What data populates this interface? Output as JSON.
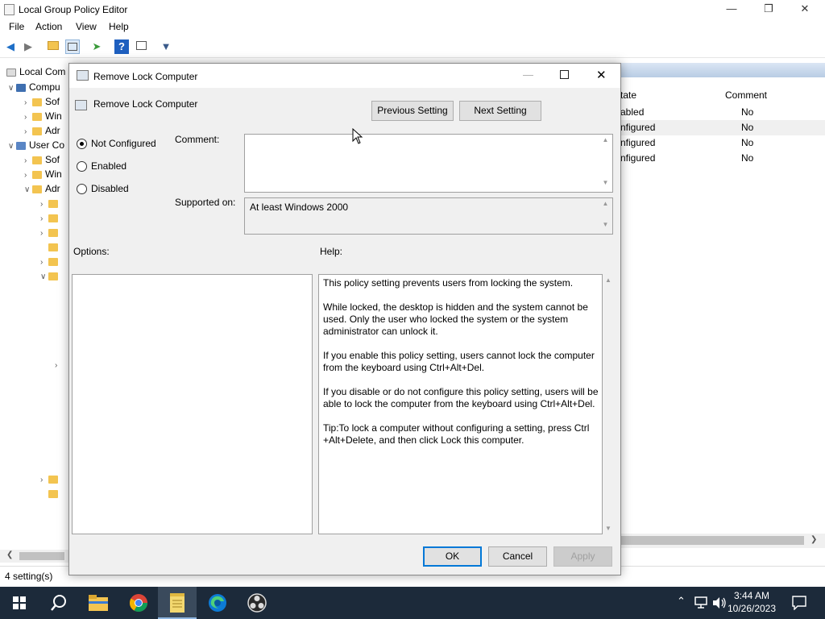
{
  "main_window": {
    "title": "Local Group Policy Editor",
    "controls": {
      "minimize": "—",
      "restore": "❐",
      "close": "✕"
    },
    "menu": [
      "File",
      "Action",
      "View",
      "Help"
    ],
    "toolbar_icons": [
      "back-arrow-icon",
      "forward-arrow-icon",
      "folder-up-icon",
      "show-hide-tree-icon",
      "export-list-icon",
      "help-icon",
      "properties-icon",
      "filter-icon"
    ],
    "tree": [
      {
        "label": "Local Com",
        "indent": 0
      },
      {
        "label": "Compu",
        "indent": 1
      },
      {
        "label": "Sof",
        "indent": 2
      },
      {
        "label": "Win",
        "indent": 2
      },
      {
        "label": "Adr",
        "indent": 2
      },
      {
        "label": "User Co",
        "indent": 1
      },
      {
        "label": "Sof",
        "indent": 2
      },
      {
        "label": "Win",
        "indent": 2
      },
      {
        "label": "Adr",
        "indent": 2
      }
    ],
    "list": {
      "columns": [
        "tate",
        "Comment"
      ],
      "rows": [
        {
          "state": "abled",
          "comment": "No"
        },
        {
          "state": "nfigured",
          "comment": "No"
        },
        {
          "state": "nfigured",
          "comment": "No"
        },
        {
          "state": "nfigured",
          "comment": "No"
        }
      ]
    },
    "status": "4 setting(s)"
  },
  "dialog": {
    "title": "Remove Lock Computer",
    "setting_name": "Remove Lock Computer",
    "prev_label": "Previous Setting",
    "next_label": "Next Setting",
    "options": [
      {
        "label": "Not Configured",
        "selected": true
      },
      {
        "label": "Enabled",
        "selected": false
      },
      {
        "label": "Disabled",
        "selected": false
      }
    ],
    "comment_label": "Comment:",
    "comment_value": "",
    "supported_label": "Supported on:",
    "supported_value": "At least Windows 2000",
    "options_label": "Options:",
    "help_label": "Help:",
    "help_paragraphs": [
      "This policy setting prevents users from locking the system.",
      "While locked, the desktop is hidden and the system cannot be used. Only the user who locked the system or the system administrator can unlock it.",
      "If you enable this policy setting, users cannot lock the computer from the keyboard using Ctrl+Alt+Del.",
      "If you disable or do not configure this policy setting, users will be able to lock the computer from the keyboard using Ctrl+Alt+Del.",
      "Tip:To lock a computer without configuring a setting, press Ctrl +Alt+Delete, and then click Lock this computer."
    ],
    "ok_label": "OK",
    "cancel_label": "Cancel",
    "apply_label": "Apply"
  },
  "taskbar": {
    "items": [
      "start-icon",
      "search-icon",
      "file-explorer-icon",
      "chrome-icon",
      "notepad-icon",
      "edge-icon",
      "obs-icon"
    ],
    "time": "3:44 AM",
    "date": "10/26/2023"
  }
}
